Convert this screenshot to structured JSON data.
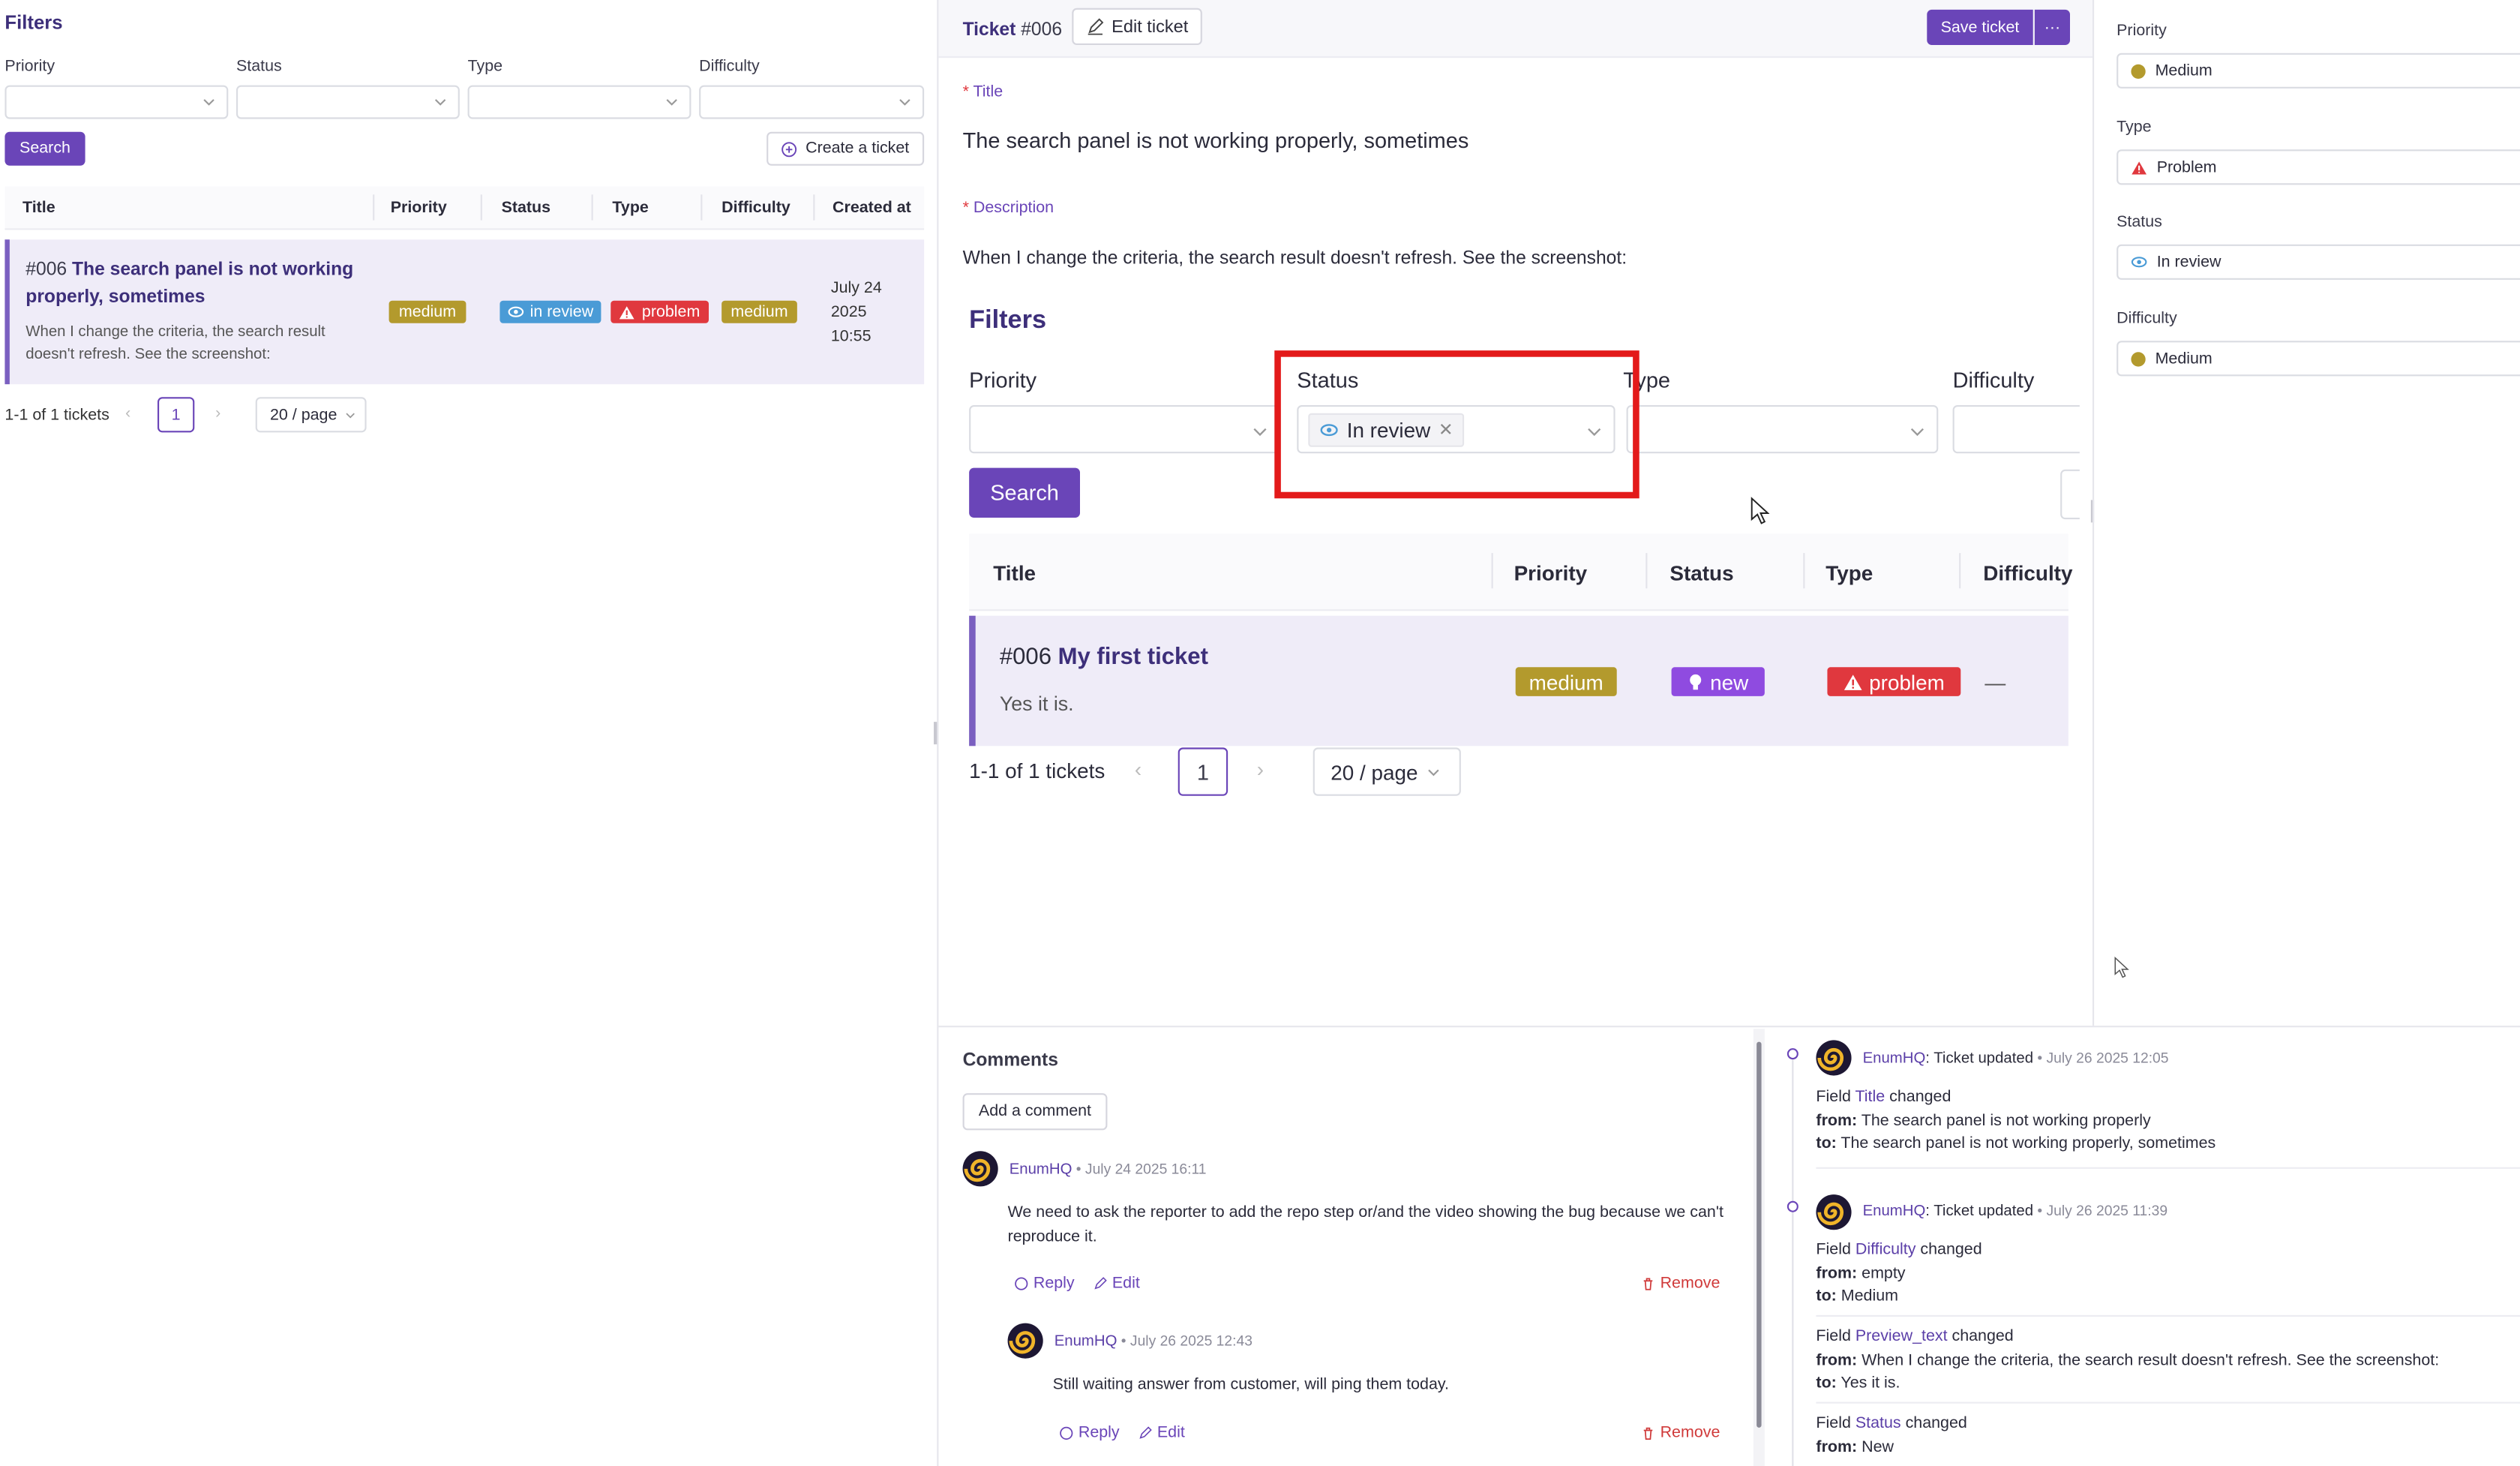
{
  "list": {
    "filters_title": "Filters",
    "filter_labels": [
      "Priority",
      "Status",
      "Type",
      "Difficulty"
    ],
    "search_label": "Search",
    "create_label": "Create a ticket",
    "columns": [
      "Title",
      "Priority",
      "Status",
      "Type",
      "Difficulty",
      "Created at"
    ],
    "row": {
      "number": "#006",
      "title": "The search panel is not working properly, sometimes",
      "preview": "When I change the criteria, the search result doesn't refresh. See the screenshot:",
      "priority": "medium",
      "status": "in review",
      "type": "problem",
      "difficulty": "medium",
      "created": [
        "July 24",
        "2025",
        "10:55"
      ]
    },
    "pagination": {
      "total": "1-1 of 1 tickets",
      "page": "1",
      "per_page": "20 / page"
    }
  },
  "detail": {
    "ticket_label": "Ticket",
    "ticket_number": "#006",
    "edit_label": "Edit ticket",
    "save_label": "Save ticket",
    "more_label": "···",
    "title_label": "Title",
    "title_value": "The search panel is not working properly, sometimes",
    "description_label": "Description",
    "description_text": "When I change the criteria, the search result doesn't refresh. See the screenshot:",
    "screenshot": {
      "filters_title": "Filters",
      "filter_labels": [
        "Priority",
        "Status",
        "Type",
        "Difficulty"
      ],
      "status_chip": "In review",
      "search_label": "Search",
      "columns": [
        "Title",
        "Priority",
        "Status",
        "Type",
        "Difficulty"
      ],
      "row": {
        "number": "#006",
        "title": "My first ticket",
        "preview": "Yes it is.",
        "priority": "medium",
        "status": "new",
        "type": "problem",
        "difficulty": "—"
      },
      "pagination": {
        "total": "1-1 of 1 tickets",
        "page": "1",
        "per_page": "20 / page"
      }
    }
  },
  "sidebar": {
    "fields": [
      {
        "label": "Priority",
        "value": "Medium",
        "color": "#b39a2d"
      },
      {
        "label": "Type",
        "value": "Problem",
        "color": "#e0383e"
      },
      {
        "label": "Status",
        "value": "In review",
        "color": "#4a9bd6"
      },
      {
        "label": "Difficulty",
        "value": "Medium",
        "color": "#b39a2d"
      }
    ]
  },
  "comments": {
    "title": "Comments",
    "add_label": "Add a comment",
    "items": [
      {
        "author": "EnumHQ",
        "date": "July 24 2025 16:11",
        "text1": "We need to ask the reporter to add the repo step or/and the video showing the bug because we can't",
        "text2": "reproduce it.",
        "reply": "Reply",
        "edit": "Edit",
        "remove": "Remove"
      },
      {
        "author": "EnumHQ",
        "date": "July 26 2025 12:43",
        "text1": "Still waiting answer from customer, will ping them today.",
        "reply": "Reply",
        "edit": "Edit",
        "remove": "Remove"
      }
    ]
  },
  "history": {
    "entries": [
      {
        "author": "EnumHQ",
        "action": ": Ticket updated",
        "date": "July 26 2025 12:05",
        "changes": [
          {
            "field": "Title",
            "from": "The search panel is not working properly",
            "to": "The search panel is not working properly, sometimes"
          }
        ]
      },
      {
        "author": "EnumHQ",
        "action": ": Ticket updated",
        "date": "July 26 2025 11:39",
        "changes": [
          {
            "field": "Difficulty",
            "from": "empty",
            "to": "Medium"
          },
          {
            "field": "Preview_text",
            "from": "When I change the criteria, the search result doesn't refresh. See the screenshot:",
            "to": "Yes it is."
          },
          {
            "field": "Status",
            "from": "New"
          }
        ]
      }
    ],
    "field_word": "Field",
    "changed_word": "changed",
    "from_word": "from:",
    "to_word": "to:"
  },
  "colors": {
    "accent": "#6a45b8",
    "medium": "#b39a2d",
    "in_review": "#4a9bd6",
    "problem": "#e0383e",
    "new": "#8f4be0",
    "highlight": "#e31a1a"
  }
}
